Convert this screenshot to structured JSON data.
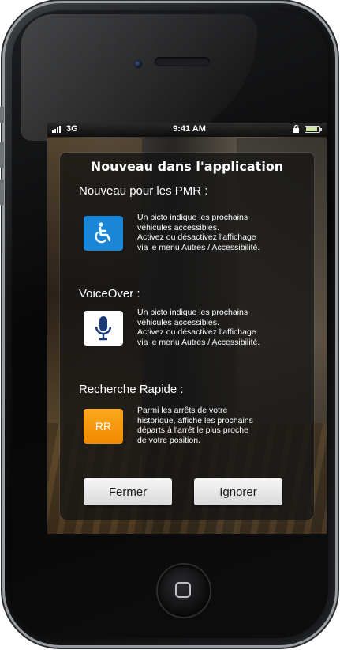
{
  "status_bar": {
    "network": "3G",
    "time": "9:41 AM",
    "battery_level": 0.9
  },
  "dialog": {
    "title": "Nouveau dans l'application",
    "sections": [
      {
        "title": "Nouveau pour les PMR :",
        "icon": "wheelchair-icon",
        "text": "Un picto indique les prochains\nvéhicules accessibles.\nActivez ou désactivez l'affichage\nvia le menu Autres / Accessibilité."
      },
      {
        "title": "VoiceOver :",
        "icon": "microphone-icon",
        "text": "Un picto indique les prochains\nvéhicules accessibles.\nActivez ou désactivez l'affichage\nvia le menu Autres / Accessibilité."
      },
      {
        "title": "Recherche Rapide :",
        "icon": "rr-icon",
        "icon_label": "RR",
        "text": "Parmi les arrêts de votre\nhistorique, affiche les prochains\ndéparts à l'arrêt le plus proche\nde votre position."
      }
    ],
    "buttons": {
      "close": "Fermer",
      "ignore": "Ignorer"
    }
  },
  "colors": {
    "pmr_blue": "#1c86d6",
    "rr_orange": "#f59a0a",
    "dialog_bg": "#141414"
  }
}
